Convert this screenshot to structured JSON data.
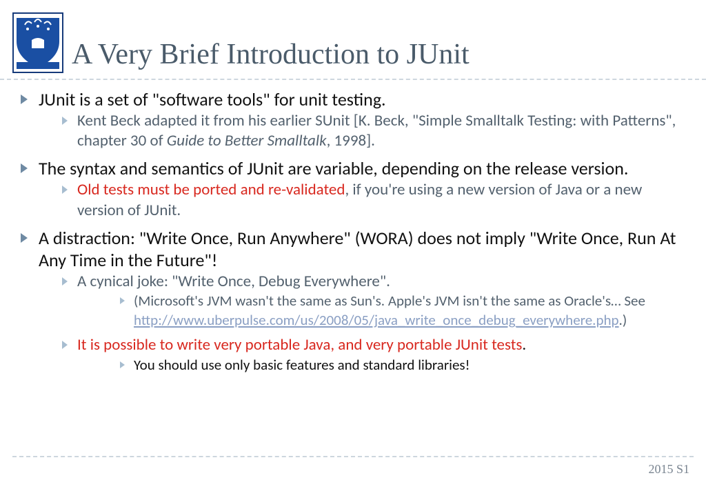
{
  "title": "A Very Brief Introduction to JUnit",
  "footer": "2015 S1",
  "b1": {
    "t1": "JUnit is a set of \"software tools\" for unit testing.",
    "s1a": "Kent Beck adapted it from his earlier SUnit [K. Beck, \"Simple Smalltalk Testing: with Patterns\", chapter 30 of ",
    "s1b": "Guide to Better Smalltalk",
    "s1c": ", 1998]."
  },
  "b2": {
    "t1": "The syntax and semantics of JUnit are variable, depending on the release version.",
    "s1a": "Old tests must be ported and re-validated",
    "s1b": ", if you're using a new version of Java or a new version of JUnit."
  },
  "b3": {
    "t1": "A distraction: \"Write Once, Run Anywhere\" (WORA) does not imply \"Write Once, Run At Any Time in the Future\"!",
    "s1": "A cynical joke: \"Write Once, Debug Everywhere\".",
    "ss1a": "(Microsoft's JVM wasn't the same as Sun's.  Apple's JVM isn't the same as Oracle's… See ",
    "ss1link": "http://www.uberpulse.com/us/2008/05/java_write_once_debug_everywhere.php",
    "ss1b": ".)",
    "s2": "It is possible to write very portable Java, and very portable JUnit tests",
    "s2b": ".",
    "ss2": "You should use only basic features and standard libraries!"
  }
}
